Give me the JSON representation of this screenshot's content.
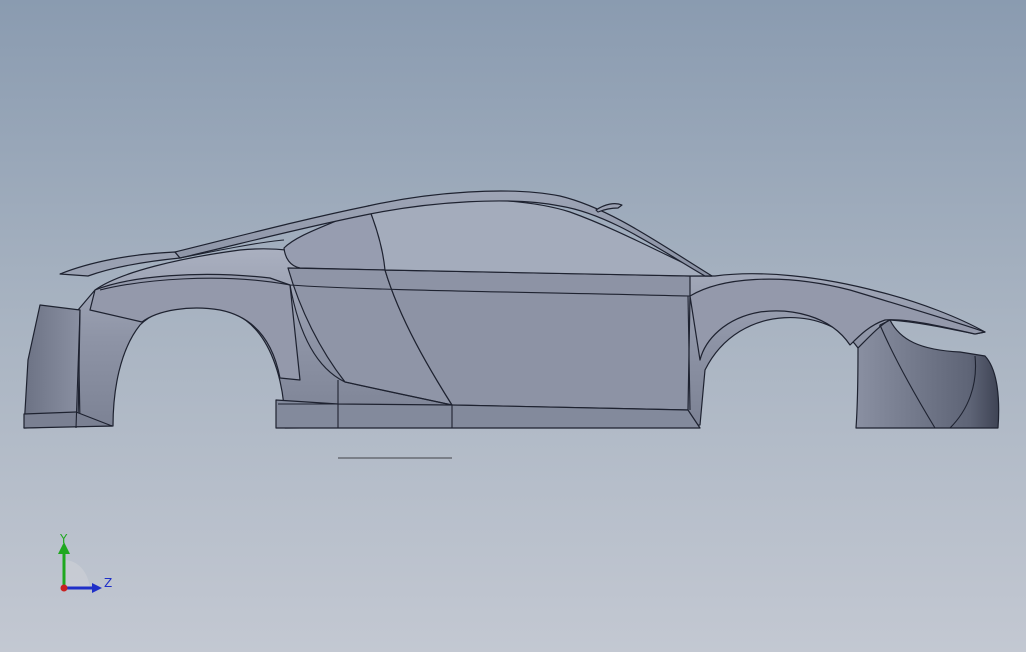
{
  "viewport": {
    "background_top": "#8a9bb0",
    "background_bottom": "#c3c8d2"
  },
  "model": {
    "body_color": "#8a90a2",
    "edge_color": "#1e2230"
  },
  "triad": {
    "y_label": "Y",
    "z_label": "Z",
    "y_color": "#1fa81f",
    "z_color": "#1f2fc8",
    "origin_color": "#c82020"
  }
}
